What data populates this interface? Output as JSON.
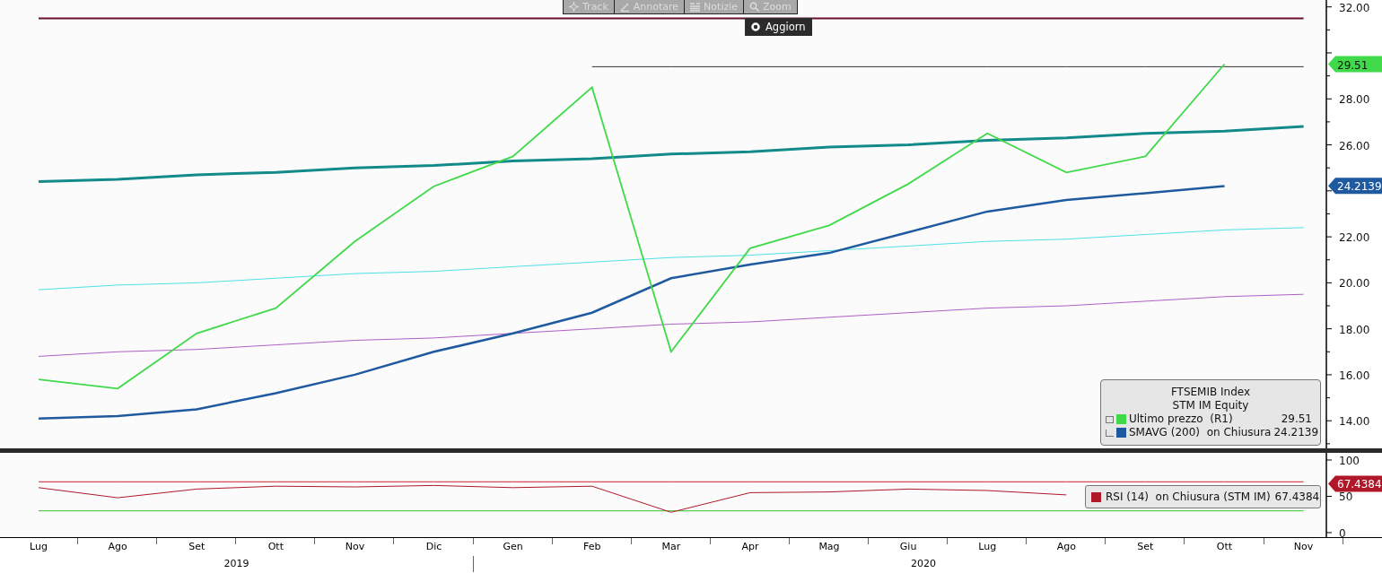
{
  "toolbar": {
    "buttons": [
      {
        "label": "Track",
        "kind": "track",
        "disabled": true
      },
      {
        "label": "Annotare",
        "kind": "annotate",
        "disabled": true
      },
      {
        "label": "Notizie",
        "kind": "news",
        "disabled": true
      },
      {
        "label": "Zoom",
        "kind": "zoom",
        "disabled": true
      }
    ],
    "refresh_button": "Aggiorn"
  },
  "price_chart": {
    "chart_data": {
      "type": "line",
      "categories": [
        "Lug",
        "Ago",
        "Set",
        "Ott",
        "Nov",
        "Dic",
        "Gen",
        "Feb",
        "Mar",
        "Apr",
        "Mag",
        "Giu",
        "Lug",
        "Ago",
        "Set",
        "Ott",
        "Nov"
      ],
      "series": [
        {
          "name": "Ultimo prezzo  (R1)",
          "color": "#3fd94a",
          "values": [
            15.8,
            15.4,
            17.8,
            18.9,
            21.8,
            24.2,
            25.5,
            28.5,
            17.0,
            21.5,
            22.5,
            24.3,
            26.5,
            24.8,
            25.5,
            29.51,
            null
          ]
        },
        {
          "name": "SMAVG (200)  on Chiusura",
          "color": "#1f5aa0",
          "values": [
            14.1,
            14.2,
            14.5,
            15.2,
            16.0,
            17.0,
            17.8,
            18.7,
            20.2,
            20.8,
            21.3,
            22.2,
            23.1,
            23.6,
            23.9,
            24.21,
            null
          ]
        },
        {
          "color": "#138a8a",
          "values": [
            24.4,
            24.5,
            24.7,
            24.8,
            25.0,
            25.1,
            25.3,
            25.4,
            25.6,
            25.7,
            25.9,
            26.0,
            26.2,
            26.3,
            26.5,
            26.6,
            26.8
          ]
        },
        {
          "color": "#4fe0e8",
          "values": [
            19.7,
            19.9,
            20.0,
            20.2,
            20.4,
            20.5,
            20.7,
            20.9,
            21.1,
            21.2,
            21.4,
            21.6,
            21.8,
            21.9,
            22.1,
            22.3,
            22.4
          ]
        },
        {
          "color": "#b060c8",
          "values": [
            16.8,
            17.0,
            17.1,
            17.3,
            17.5,
            17.6,
            17.8,
            18.0,
            18.2,
            18.3,
            18.5,
            18.7,
            18.9,
            19.0,
            19.2,
            19.4,
            19.5
          ]
        },
        {
          "color": "#6b1030",
          "values": [
            31.5,
            31.5,
            31.5,
            31.5,
            31.5,
            31.5,
            31.5,
            31.5,
            31.5,
            31.5,
            31.5,
            31.5,
            31.5,
            31.5,
            31.5,
            31.5,
            31.5
          ]
        },
        {
          "color": "#333333",
          "values": [
            null,
            null,
            null,
            null,
            null,
            null,
            null,
            29.4,
            29.4,
            29.4,
            29.4,
            29.4,
            29.4,
            29.4,
            29.4,
            29.4,
            29.4
          ]
        }
      ],
      "ylim": [
        12.8,
        32.3
      ],
      "yticks": [
        {
          "value": 14,
          "label": "14.00"
        },
        {
          "value": 16,
          "label": "16.00"
        },
        {
          "value": 18,
          "label": "18.00"
        },
        {
          "value": 20,
          "label": "20.00"
        },
        {
          "value": 22,
          "label": "22.00"
        },
        {
          "value": 26,
          "label": "26.00"
        },
        {
          "value": 28,
          "label": "28.00"
        },
        {
          "value": 32,
          "label": "32.00"
        }
      ]
    },
    "axis_badges": [
      {
        "text": "29.51",
        "color": "#3fd94a"
      },
      {
        "text": "24.2139",
        "color": "#1f5aa0"
      }
    ],
    "legend": {
      "title_lines": [
        "FTSEMIB Index",
        "STM IM Equity"
      ],
      "values": [
        "29.51",
        "24.2139"
      ]
    }
  },
  "rsi_chart": {
    "chart_data": {
      "type": "line",
      "categories": [
        null,
        null,
        null,
        null,
        null,
        null,
        null,
        null,
        null,
        null,
        null,
        null,
        null,
        null,
        null,
        null,
        null
      ],
      "series": [
        {
          "name": "RSI (14)  on Chiusura (STM IM)",
          "color": "#b0182a",
          "values": [
            62,
            48,
            60,
            64,
            63,
            65,
            62,
            64,
            28,
            55,
            56,
            60,
            58,
            52,
            null,
            null,
            null
          ]
        },
        {
          "color": "#d02030",
          "values": [
            70,
            70,
            70,
            70,
            70,
            70,
            70,
            70,
            70,
            70,
            70,
            70,
            70,
            70,
            70,
            70,
            70
          ]
        },
        {
          "color": "#30c030",
          "values": [
            30,
            30,
            30,
            30,
            30,
            30,
            30,
            30,
            30,
            30,
            30,
            30,
            30,
            30,
            30,
            30,
            30
          ]
        }
      ],
      "ylim": [
        -6.2,
        109.9
      ],
      "yticks": [
        0,
        50,
        100
      ]
    },
    "axis_badge": {
      "text": "67.4384",
      "color": "#b0182a"
    },
    "legend_value": "67.4384"
  },
  "x_axis": {
    "years": [
      "2019",
      "2020"
    ]
  }
}
